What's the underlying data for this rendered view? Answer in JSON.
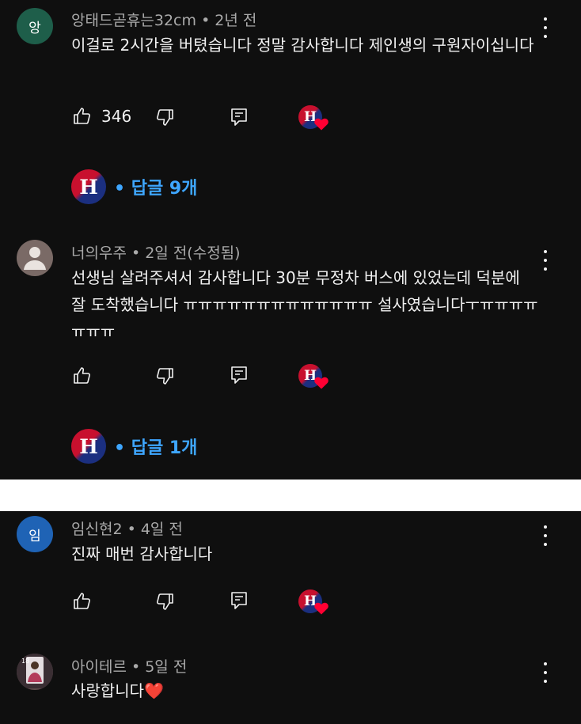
{
  "comments": [
    {
      "avatar_initial": "앙",
      "avatar_color": "#1e5e4a",
      "author": "앙태드곧휴는32cm",
      "time": "• 2년 전",
      "text": "이걸로 2시간을 버텼습니다 정말 감사합니다 제인생의 구원자이십니다",
      "likes": "346",
      "replies_label": "• 답글 9개"
    },
    {
      "avatar_initial": "",
      "avatar_color": "#7a6a66",
      "author": "너의우주",
      "time": "• 2일 전(수정됨)",
      "text": "선생님 살려주셔서 감사합니다 30분 무정차 버스에 있었는데 덕분에 잘 도착했습니다 ㅠㅠㅠㅠㅠㅠㅠㅠㅠㅠㅠㅠㅠ 설사였습니다ㅜㅠㅠㅠㅠㅠㅠㅠ",
      "likes": "",
      "replies_label": "• 답글 1개"
    },
    {
      "avatar_initial": "임",
      "avatar_color": "#1f63b5",
      "author": "임신현2",
      "time": "• 4일 전",
      "text": "진짜 매번 감사합니다",
      "likes": ""
    },
    {
      "avatar_initial": "",
      "avatar_color": "#5c4a4a",
      "author": "아이테르",
      "time": "• 5일 전",
      "text": "사랑합니다❤️"
    }
  ],
  "creator_logo_letter": "H",
  "colors": {
    "background": "#0f0f0f",
    "reply_link": "#3ea6ff",
    "heart": "#ff0033",
    "separator": "#ffffff"
  }
}
